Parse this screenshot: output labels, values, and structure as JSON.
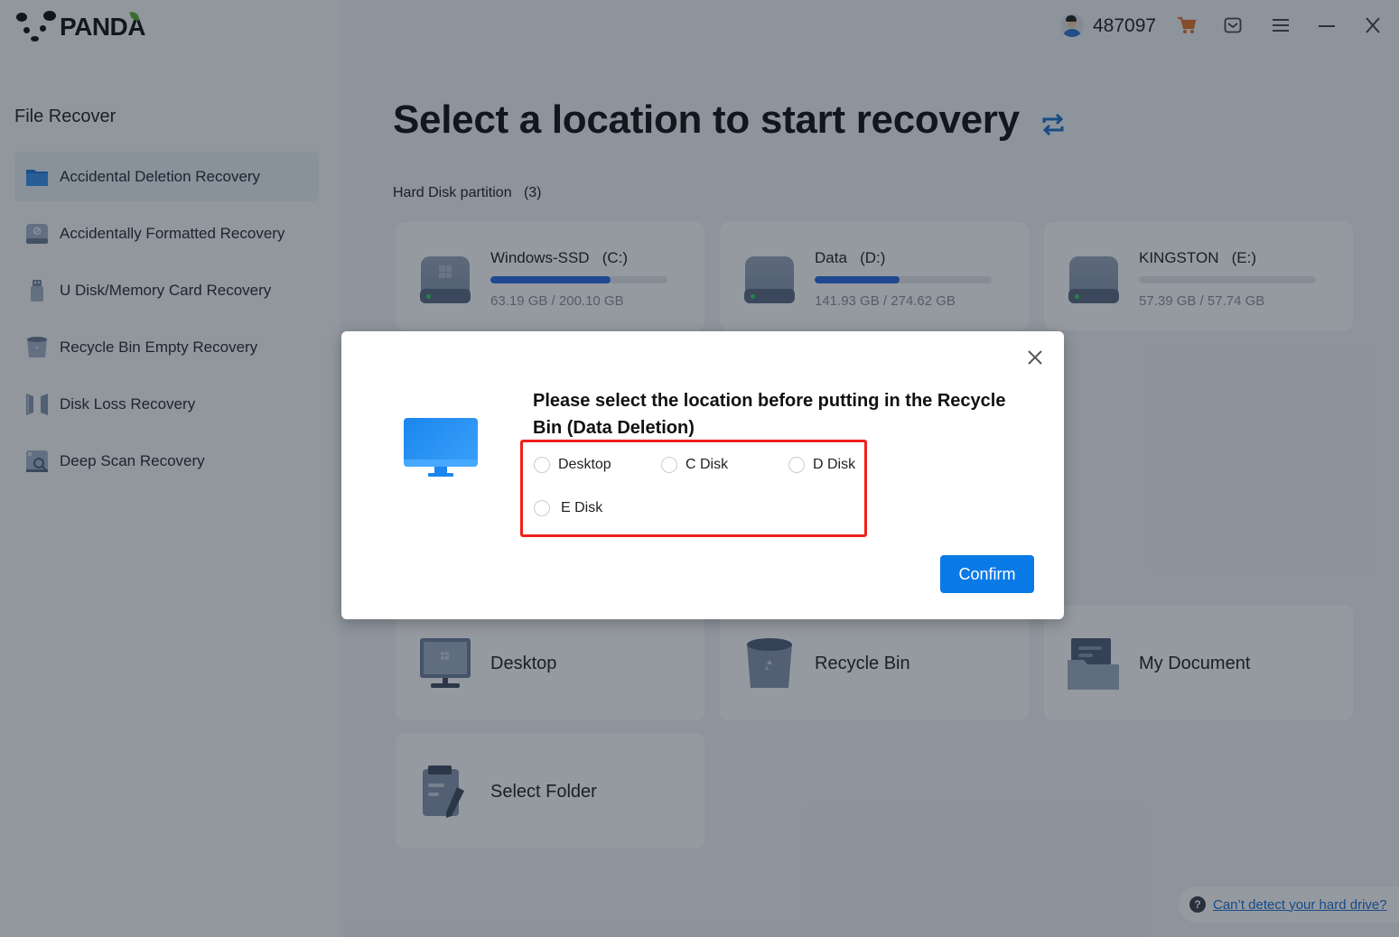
{
  "app": {
    "brand": "PANDA"
  },
  "topbar": {
    "user_id": "487097",
    "icons": [
      "avatar",
      "cart-icon",
      "message-icon",
      "menu-icon",
      "minimize-icon",
      "close-icon"
    ],
    "cart_color": "#e0722a"
  },
  "sidebar": {
    "title": "File Recover",
    "items": [
      {
        "label": "Accidental Deletion Recovery",
        "icon": "folder-icon",
        "active": true
      },
      {
        "label": "Accidentally Formatted Recovery",
        "icon": "formatted-disk-icon",
        "active": false
      },
      {
        "label": "U Disk/Memory Card Recovery",
        "icon": "usb-drive-icon",
        "active": false
      },
      {
        "label": "Recycle Bin Empty Recovery",
        "icon": "recycle-bin-icon",
        "active": false
      },
      {
        "label": "Disk Loss Recovery",
        "icon": "disk-loss-icon",
        "active": false
      },
      {
        "label": "Deep Scan Recovery",
        "icon": "deep-scan-icon",
        "active": false
      }
    ]
  },
  "main": {
    "title": "Select a location to start recovery",
    "section_label": "Hard Disk partition   (3)",
    "disks": [
      {
        "name": "Windows-SSD   (C:)",
        "used_fraction": 0.68,
        "size": "63.19 GB / 200.10 GB",
        "windows": true
      },
      {
        "name": "Data   (D:)",
        "used_fraction": 0.48,
        "size": "141.93 GB / 274.62 GB",
        "windows": false
      },
      {
        "name": "KINGSTON   (E:)",
        "used_fraction": 0.0,
        "size": "57.39 GB / 57.74 GB",
        "windows": false
      }
    ],
    "locations": [
      {
        "name": "Desktop",
        "icon": "desktop-icon"
      },
      {
        "name": "Recycle Bin",
        "icon": "recycle-bin-icon"
      },
      {
        "name": "My Document",
        "icon": "document-folder-icon"
      },
      {
        "name": "Select Folder",
        "icon": "select-folder-icon"
      }
    ],
    "help_link": "Can’t detect your hard drive?"
  },
  "dialog": {
    "title": "Please select the location before putting in the Recycle Bin (Data Deletion)",
    "options": [
      "Desktop",
      "C Disk",
      "D Disk",
      "E Disk"
    ],
    "selected": null,
    "confirm_label": "Confirm",
    "highlight_color": "#f0201c",
    "accent": "#0a7ae6"
  }
}
